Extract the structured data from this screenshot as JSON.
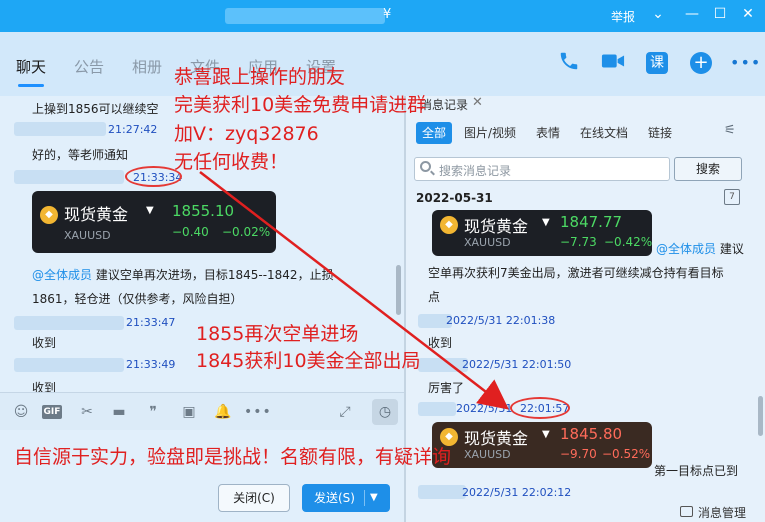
{
  "titlebar": {
    "title_tail": "¥",
    "report": "举报",
    "minimize": "⌄",
    "restore": "—",
    "maximize": "☐",
    "close": "✕"
  },
  "toolbar": {
    "tabs": [
      "聊天",
      "公告",
      "相册",
      "文件",
      "应用",
      "设置"
    ],
    "ke_label": "课"
  },
  "chat": {
    "messages": [
      {
        "text": "上操到1856可以继续空"
      },
      {
        "time": "21:27:42"
      },
      {
        "text": "好的，等老师通知"
      },
      {
        "time": "21:33:34"
      },
      {
        "mention": "@全体成员",
        "text": " 建议空单再次进场，目标1845--1842，止损"
      },
      {
        "text": "1861，轻仓进（仅供参考，风险自担）"
      },
      {
        "time": "21:33:47"
      },
      {
        "text": "收到"
      },
      {
        "time": "21:33:49"
      },
      {
        "text": "收到"
      }
    ],
    "card": {
      "name": "现货黄金",
      "code": "XAUUSD",
      "price": "1855.10",
      "change": "−0.40",
      "pct": "−0.02%"
    }
  },
  "compose": {
    "close_label": "关闭(C)",
    "send_label": "发送(S)"
  },
  "panel": {
    "tab_title": "消息记录",
    "filters": [
      "全部",
      "图片/视频",
      "表情",
      "在线文档",
      "链接"
    ],
    "search_placeholder": "搜索消息记录",
    "search_button": "搜索",
    "date": "2022-05-31",
    "card1": {
      "name": "现货黄金",
      "code": "XAUUSD",
      "price": "1847.77",
      "change": "−7.73",
      "pct": "−0.42%"
    },
    "mention": "@全体成员",
    "line1_tail": " 建议",
    "line2": "空单再次获利7美金出局，激进者可继续减仓持有看目标",
    "line3": "点",
    "time1": "2022/5/31 22:01:38",
    "reply1": "收到",
    "time2": "2022/5/31 22:01:50",
    "reply2": "厉害了",
    "time3_date": "2022/5/31",
    "time3": "22:01:57",
    "card2": {
      "name": "现货黄金",
      "code": "XAUUSD",
      "price": "1845.80",
      "change": "−9.70",
      "pct": "−0.52%"
    },
    "card2_side": "第一目标点已到",
    "time4": "2022/5/31 22:02:12",
    "manage": "消息管理"
  },
  "overlay": {
    "line1": "恭喜跟上操作的朋友",
    "line2": "完美获利10美金免费申请进群",
    "line3": "加V：zyq32876",
    "line4": "无任何收费！",
    "mid1": "1855再次空单进场",
    "mid2": "1845获利10美金全部出局",
    "bottom": "自信源于实力，验盘即是挑战！名额有限，有疑详询"
  },
  "colors": {
    "accent": "#1e8fe8",
    "overlay_red": "#e02020",
    "price_green": "#4cd964",
    "price_red": "#ff6b5a"
  }
}
